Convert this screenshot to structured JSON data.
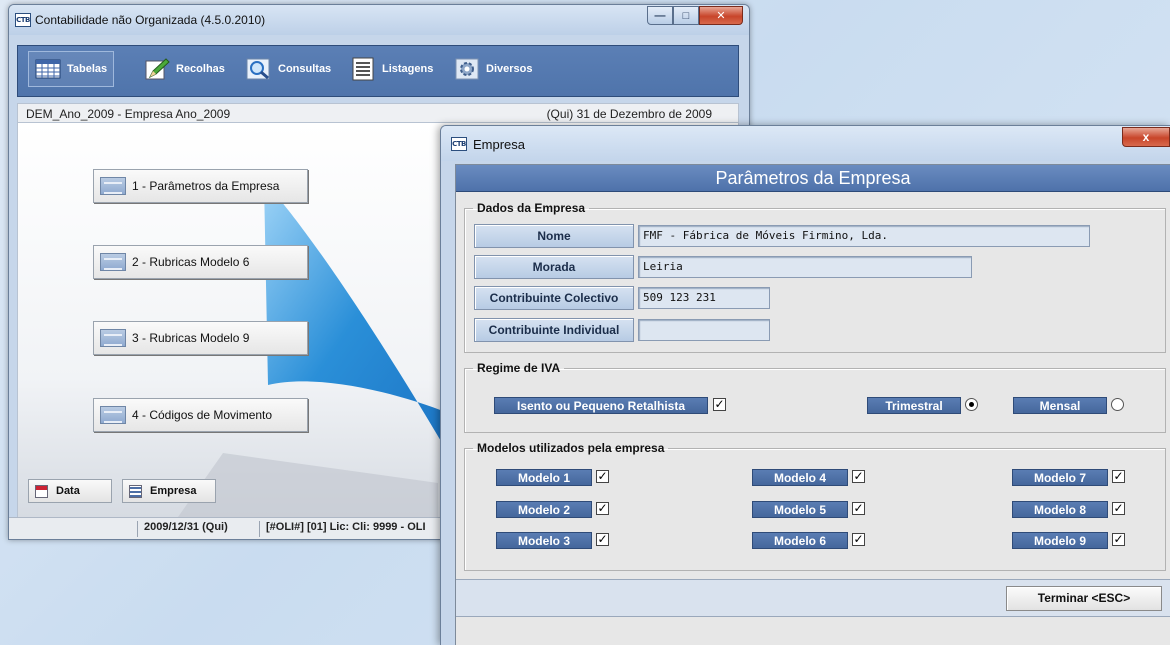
{
  "main_window": {
    "title": "Contabilidade não Organizada (4.5.0.2010)",
    "icon_text": "CTB",
    "toolbar": [
      {
        "label": "Tabelas",
        "icon": "table-icon"
      },
      {
        "label": "Recolhas",
        "icon": "pencil-icon"
      },
      {
        "label": "Consultas",
        "icon": "magnifier-icon"
      },
      {
        "label": "Listagens",
        "icon": "list-icon"
      },
      {
        "label": "Diversos",
        "icon": "gear-icon"
      }
    ],
    "info_left": "DEM_Ano_2009 - Empresa Ano_2009",
    "info_right": "(Qui) 31 de Dezembro de 2009",
    "menu_items": [
      "1 - Parâmetros da Empresa",
      "2 - Rubricas Modelo 6",
      "3 - Rubricas Modelo 9",
      "4 - Códigos de Movimento"
    ],
    "bottom_buttons": {
      "data": "Data",
      "empresa": "Empresa"
    },
    "status": {
      "date": "2009/12/31 (Qui)",
      "license": "[#OLI#] [01] Lic:  Cli: 9999 - OLI"
    }
  },
  "dialog": {
    "title": "Empresa",
    "icon_text": "CTB",
    "close": "x",
    "header": "Parâmetros da Empresa",
    "dados": {
      "legend": "Dados da Empresa",
      "nome_label": "Nome",
      "nome_value": "FMF - Fábrica de Móveis Firmino, Lda.",
      "morada_label": "Morada",
      "morada_value": "Leiria",
      "colectivo_label": "Contribuinte Colectivo",
      "colectivo_value": "509 123 231",
      "individual_label": "Contribuinte Individual",
      "individual_value": ""
    },
    "iva": {
      "legend": "Regime de IVA",
      "isento_label": "Isento ou Pequeno Retalhista",
      "isento_checked": true,
      "trimestral_label": "Trimestral",
      "trimestral_selected": true,
      "mensal_label": "Mensal",
      "mensal_selected": false
    },
    "modelos": {
      "legend": "Modelos utilizados pela empresa",
      "items": [
        {
          "label": "Modelo 1",
          "checked": true
        },
        {
          "label": "Modelo 2",
          "checked": true
        },
        {
          "label": "Modelo 3",
          "checked": true
        },
        {
          "label": "Modelo 4",
          "checked": true
        },
        {
          "label": "Modelo 5",
          "checked": true
        },
        {
          "label": "Modelo 6",
          "checked": true
        },
        {
          "label": "Modelo 7",
          "checked": true
        },
        {
          "label": "Modelo 8",
          "checked": true
        },
        {
          "label": "Modelo 9",
          "checked": true
        }
      ]
    },
    "terminar_label": "Terminar <ESC>"
  },
  "colors": {
    "toolbar_blue": "#5b7fb5",
    "header_blue": "#4e72aa",
    "accent_teal": "#2a8fd8",
    "window_frame": "#c6d6ea"
  }
}
